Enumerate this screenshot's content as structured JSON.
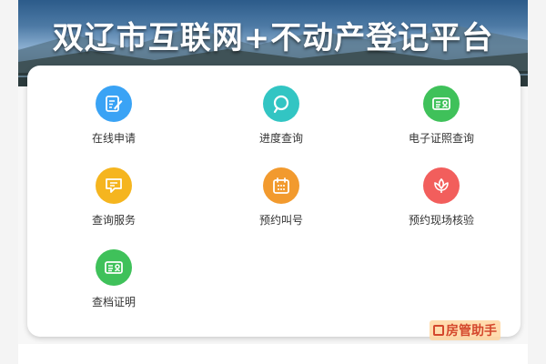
{
  "header": {
    "title": "双辽市互联网+不动产登记平台"
  },
  "services": [
    {
      "label": "在线申请",
      "icon": "edit-form-icon",
      "color": "#3aa3f5"
    },
    {
      "label": "进度查询",
      "icon": "search-icon",
      "color": "#32c5c3"
    },
    {
      "label": "电子证照查询",
      "icon": "id-card-icon",
      "color": "#3fc15a"
    },
    {
      "label": "查询服务",
      "icon": "chat-bubble-icon",
      "color": "#f5b51f"
    },
    {
      "label": "预约叫号",
      "icon": "calendar-icon",
      "color": "#f29a2e"
    },
    {
      "label": "预约现场核验",
      "icon": "lotus-icon",
      "color": "#f25e5c"
    },
    {
      "label": "查档证明",
      "icon": "id-card-icon",
      "color": "#3fc15a"
    }
  ],
  "watermark": {
    "text": "房管助手"
  }
}
